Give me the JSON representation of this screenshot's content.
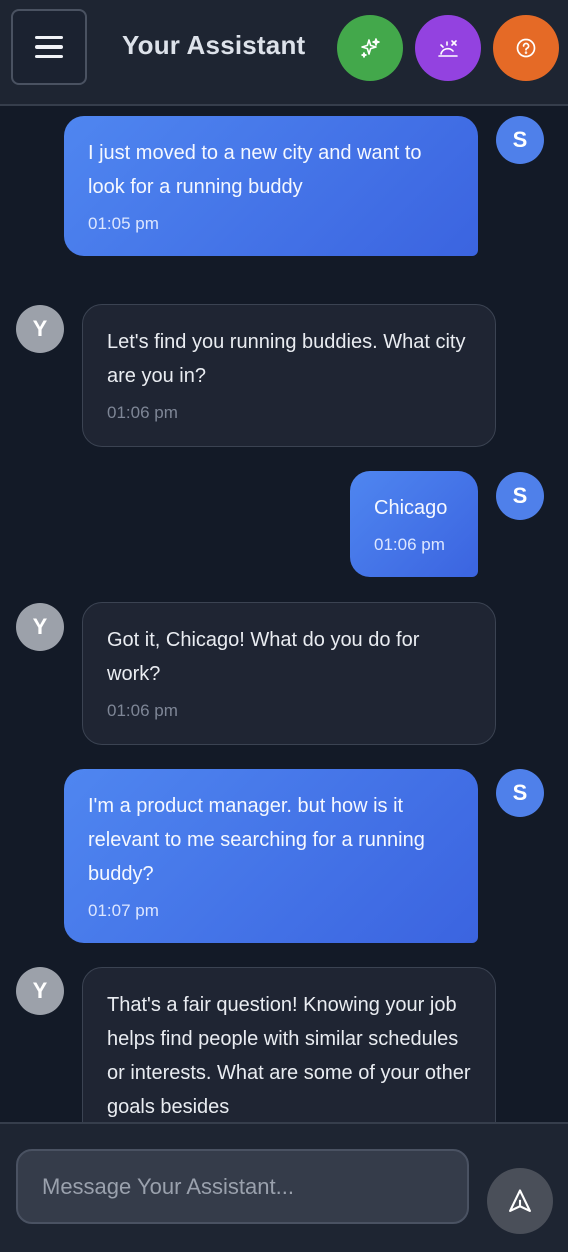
{
  "header": {
    "title": "Your Assistant",
    "menu_icon": "hamburger-menu-icon",
    "actions": [
      {
        "icon": "sparkles-icon",
        "color": "#43a84b"
      },
      {
        "icon": "sunset-weather-icon",
        "color": "#9342e0"
      },
      {
        "icon": "help-circle-icon",
        "color": "#e56a26"
      }
    ]
  },
  "messages": [
    {
      "sender": "user",
      "avatar": "S",
      "text": "I just moved to a new city and want to look for a running buddy",
      "time": "01:05 pm"
    },
    {
      "sender": "assistant",
      "avatar": "Y",
      "text": "Let's find you running buddies. What city are you in?",
      "time": "01:06 pm"
    },
    {
      "sender": "user",
      "avatar": "S",
      "text": "Chicago",
      "time": "01:06 pm"
    },
    {
      "sender": "assistant",
      "avatar": "Y",
      "text": "Got it, Chicago! What do you do for work?",
      "time": "01:06 pm"
    },
    {
      "sender": "user",
      "avatar": "S",
      "text": "I'm a product manager. but how is it relevant to me searching for a running buddy?",
      "time": "01:07 pm"
    },
    {
      "sender": "assistant",
      "avatar": "Y",
      "text": "That's a fair question! Knowing your job helps find people with similar schedules or interests. What are some of your other goals besides",
      "time": ""
    }
  ],
  "composer": {
    "placeholder": "Message Your Assistant...",
    "value": "",
    "send_icon": "send-arrow-icon"
  },
  "colors": {
    "background": "#131a27",
    "user_bubble": "#4f86f0",
    "assistant_bubble": "#1f2533",
    "user_avatar": "#4f80ea",
    "assistant_avatar": "#9ca1aa"
  }
}
